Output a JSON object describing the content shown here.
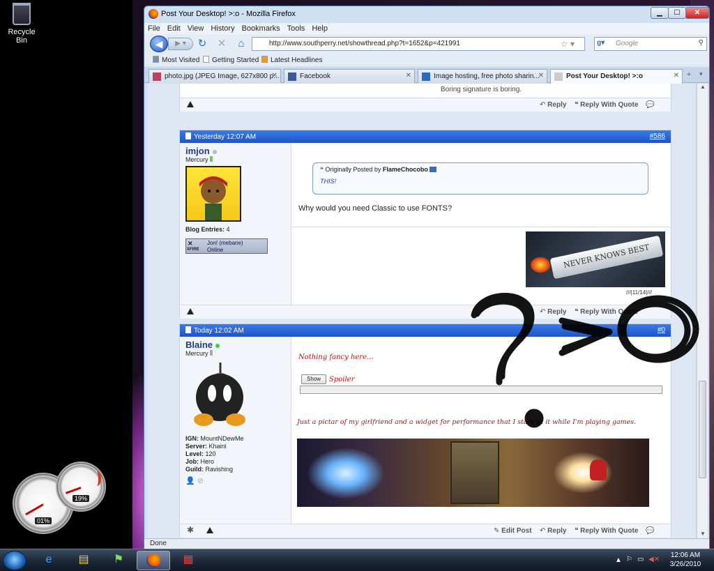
{
  "desktop": {
    "recycle_bin_label": "Recycle Bin",
    "gadget": {
      "cpu": "01%",
      "memory": "19%",
      "cpu_level": 0.01,
      "memory_level": 0.19
    }
  },
  "browser": {
    "title": "Post Your Desktop! >:o - Mozilla Firefox",
    "menu": [
      "File",
      "Edit",
      "View",
      "History",
      "Bookmarks",
      "Tools",
      "Help"
    ],
    "url": "http://www.southperry.net/showthread.php?t=1652&p=421991",
    "search_placeholder": "Google",
    "bookmarks": [
      "Most Visited",
      "Getting Started",
      "Latest Headlines"
    ],
    "tabs": [
      {
        "label": "photo.jpg (JPEG Image, 627x800 p...",
        "icon": "image-icon"
      },
      {
        "label": "Facebook",
        "icon": "facebook-icon"
      },
      {
        "label": "Image hosting, free photo sharin...",
        "icon": "photobucket-icon"
      },
      {
        "label": "Post Your Desktop! >:o",
        "icon": "page-icon",
        "active": true
      }
    ],
    "status": "Done"
  },
  "forum": {
    "prev_signature": "Boring signature is boring.",
    "reply": "Reply",
    "reply_with_quote": "Reply With Quote",
    "edit_post": "Edit Post",
    "post586": {
      "date": "Yesterday 12:07 AM",
      "number": "#586",
      "user": "imjon",
      "rank": "Mercury",
      "blog_label": "Blog Entries:",
      "blog_count": "4",
      "xfire_name": "Jon! (mebane)",
      "xfire_status": "Online",
      "xfire_logo": "XFIRE",
      "quote_prefix": "Originally Posted by",
      "quote_author": "FlameChocobo",
      "quote_text": "THIS!",
      "message": "Why would you need Classic to use FONTS?",
      "signature_text": "NEVER KNOWS BEST",
      "signature_caption": "///|11/14|///"
    },
    "post_new": {
      "date": "Today 12:02 AM",
      "number": "#0",
      "user": "Blaine",
      "rank": "Mercury",
      "ign_label": "IGN:",
      "ign": "MountNDewMe",
      "server_label": "Server:",
      "server": "Khaini",
      "level_label": "Level:",
      "level": "120",
      "job_label": "Job:",
      "job": "Hero",
      "guild_label": "Guild:",
      "guild": "Ravishing",
      "line1": "Nothing fancy here...",
      "show_button": "Show",
      "spoiler": "Spoiler",
      "line2": "Just a pictar of my girlfriend and a widget for performance that I stare at it while I'm playing games."
    }
  },
  "taskbar": {
    "time": "12:06 AM",
    "date": "3/26/2010"
  },
  "colors": {
    "post_header": "#1d55c8",
    "quote_text": "#2a3a9a",
    "post_text_red": "#c01010"
  }
}
